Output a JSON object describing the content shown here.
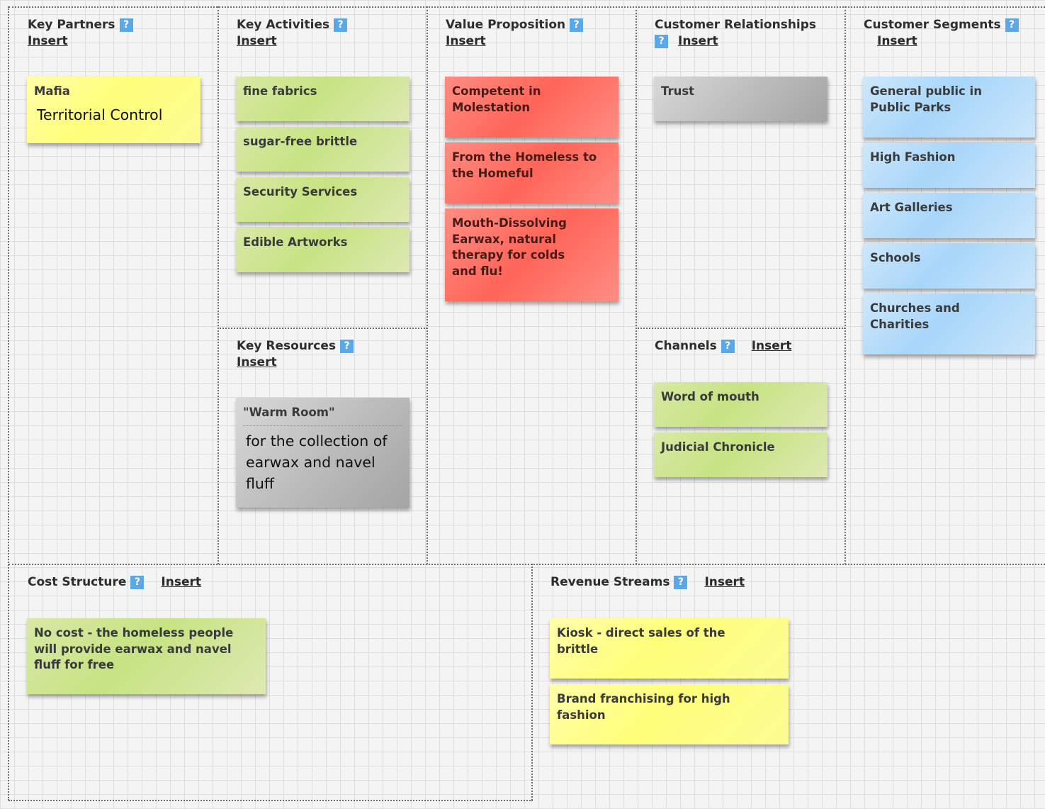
{
  "insert_label": "Insert",
  "help_icon": "?",
  "sections": {
    "key_partners": {
      "title": "Key Partners"
    },
    "key_activities": {
      "title": "Key Activities"
    },
    "value_proposition": {
      "title": "Value Proposition"
    },
    "customer_relationships": {
      "title": "Customer Relationships"
    },
    "customer_segments": {
      "title": "Customer Segments"
    },
    "key_resources": {
      "title": "Key Resources"
    },
    "channels": {
      "title": "Channels"
    },
    "cost_structure": {
      "title": "Cost Structure"
    },
    "revenue_streams": {
      "title": "Revenue Streams"
    }
  },
  "notes": {
    "key_partners": [
      {
        "title": "Mafia",
        "body": "Territorial Control",
        "color": "#ffff88"
      }
    ],
    "key_activities": [
      {
        "title": "fine fabrics",
        "color": "#cde48f"
      },
      {
        "title": "sugar-free brittle",
        "color": "#cde48f"
      },
      {
        "title": "Security Services",
        "color": "#cde48f"
      },
      {
        "title": "Edible Artworks",
        "color": "#cde48f"
      }
    ],
    "value_proposition": [
      {
        "title": "Competent in Molestation",
        "color": "#ff6f63"
      },
      {
        "title": "From the Homeless to the Homeful",
        "color": "#ff6f63"
      },
      {
        "title": "Mouth-Dissolving Earwax, natural therapy for colds and flu!",
        "color": "#ff6f63"
      }
    ],
    "customer_relationships": [
      {
        "title": "Trust",
        "color": "#b9b9b9"
      }
    ],
    "customer_segments": [
      {
        "title": "General public in Public Parks",
        "color": "#b3dbf9"
      },
      {
        "title": "High Fashion",
        "color": "#b3dbf9"
      },
      {
        "title": "Art Galleries",
        "color": "#b3dbf9"
      },
      {
        "title": "Schools",
        "color": "#b3dbf9"
      },
      {
        "title": "Churches and Charities",
        "color": "#b3dbf9"
      }
    ],
    "key_resources": [
      {
        "title": "\"Warm Room\"",
        "body": "for the collection of earwax and navel fluff",
        "color": "#bdbdbd"
      }
    ],
    "channels": [
      {
        "title": "Word of mouth",
        "color": "#cde48f"
      },
      {
        "title": "Judicial Chronicle",
        "color": "#cde48f"
      }
    ],
    "cost_structure": [
      {
        "title": "No cost - the homeless people will provide earwax and navel fluff for free",
        "color": "#cde48f"
      }
    ],
    "revenue_streams": [
      {
        "title": "Kiosk - direct sales of the brittle",
        "color": "#ffff88"
      },
      {
        "title": "Brand franchising for high fashion",
        "color": "#ffff88"
      }
    ]
  }
}
